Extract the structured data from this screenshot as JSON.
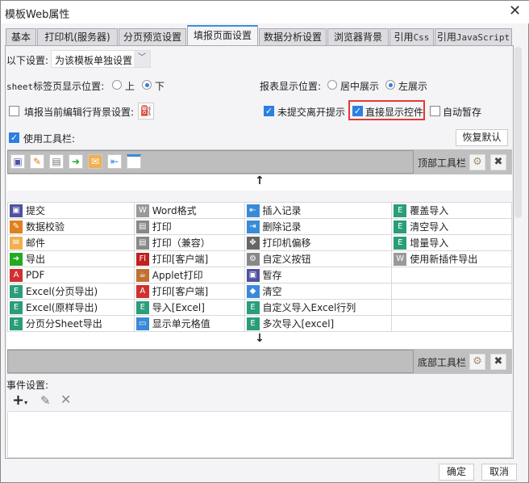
{
  "window": {
    "title": "模板Web属性",
    "close": "✕"
  },
  "tabs": [
    {
      "label": "基本"
    },
    {
      "label": "打印机(服务器)"
    },
    {
      "label": "分页预览设置"
    },
    {
      "label": "填报页面设置",
      "active": true
    },
    {
      "label": "数据分析设置"
    },
    {
      "label": "浏览器背景"
    },
    {
      "label": "引用",
      "suffix": "Css"
    },
    {
      "label": "引用",
      "suffix": "JavaScript"
    }
  ],
  "settings": {
    "scope_label": "以下设置:",
    "scope_value": "为该模板单独设置",
    "sheet_label_prefix": "sheet",
    "sheet_label": "标签页显示位置:",
    "sheet_top": "上",
    "sheet_bottom": "下",
    "sheet_selected": "下",
    "report_pos_label": "报表显示位置:",
    "report_center": "居中展示",
    "report_left": "左展示",
    "report_selected": "左展示",
    "row_bg_label": "填报当前编辑行背景设置:",
    "row_bg_checked": false,
    "unsubmitted_label": "未提交离开提示",
    "unsubmitted_checked": true,
    "direct_show_label": "直接显示控件",
    "direct_show_checked": true,
    "autosave_label": "自动暂存",
    "autosave_checked": false,
    "use_toolbar_label": "使用工具栏:",
    "use_toolbar_checked": true,
    "restore_default": "恢复默认",
    "highlight_color": "#e53935",
    "accent_color": "#2d7fe0"
  },
  "top_toolbar": {
    "label": "顶部工具栏",
    "icons": [
      "save-icon",
      "verify-icon",
      "print-icon",
      "export-icon",
      "mail-icon",
      "insert-record-icon",
      "show-cell-icon"
    ]
  },
  "bottom_toolbar": {
    "label": "底部工具栏"
  },
  "buttons_grid": [
    [
      {
        "icon": "save-icon",
        "label": "提交"
      },
      {
        "icon": "word-icon",
        "label": "Word格式"
      },
      {
        "icon": "insert-record-icon",
        "label": "插入记录"
      },
      {
        "icon": "excel-icon",
        "label": "覆盖导入"
      }
    ],
    [
      {
        "icon": "verify-icon",
        "label": "数据校验"
      },
      {
        "icon": "print-icon",
        "label": "打印"
      },
      {
        "icon": "delete-record-icon",
        "label": "删除记录"
      },
      {
        "icon": "excel-icon",
        "label": "清空导入"
      }
    ],
    [
      {
        "icon": "mail-icon",
        "label": "邮件"
      },
      {
        "icon": "print-icon",
        "label": "打印（兼容）"
      },
      {
        "icon": "move-icon",
        "label": "打印机偏移"
      },
      {
        "icon": "excel-icon",
        "label": "增量导入"
      }
    ],
    [
      {
        "icon": "export-icon",
        "label": "导出"
      },
      {
        "icon": "flash-print-icon",
        "label": "打印[客户端]"
      },
      {
        "icon": "gear-icon",
        "label": "自定义按钮"
      },
      {
        "icon": "word-icon",
        "label": "使用新插件导出"
      }
    ],
    [
      {
        "icon": "pdf-icon",
        "label": "PDF"
      },
      {
        "icon": "applet-icon",
        "label": "Applet打印"
      },
      {
        "icon": "temp-save-icon",
        "label": "暂存"
      },
      {
        "icon": "",
        "label": ""
      }
    ],
    [
      {
        "icon": "excel-icon",
        "label": "Excel(分页导出)"
      },
      {
        "icon": "pdf-print-icon",
        "label": "打印[客户端]"
      },
      {
        "icon": "eraser-icon",
        "label": "清空"
      },
      {
        "icon": "",
        "label": ""
      }
    ],
    [
      {
        "icon": "excel-icon",
        "label": "Excel(原样导出)"
      },
      {
        "icon": "excel-icon",
        "label": "导入[Excel]"
      },
      {
        "icon": "excel-icon",
        "label": "自定义导入Excel行列"
      },
      {
        "icon": "",
        "label": ""
      }
    ],
    [
      {
        "icon": "excel-icon",
        "label": "分页分Sheet导出"
      },
      {
        "icon": "show-cell-icon",
        "label": "显示单元格值"
      },
      {
        "icon": "excel-icon",
        "label": "多次导入[excel]"
      },
      {
        "icon": "",
        "label": ""
      }
    ]
  ],
  "events": {
    "label": "事件设置:"
  },
  "footer": {
    "ok": "确定",
    "cancel": "取消"
  }
}
